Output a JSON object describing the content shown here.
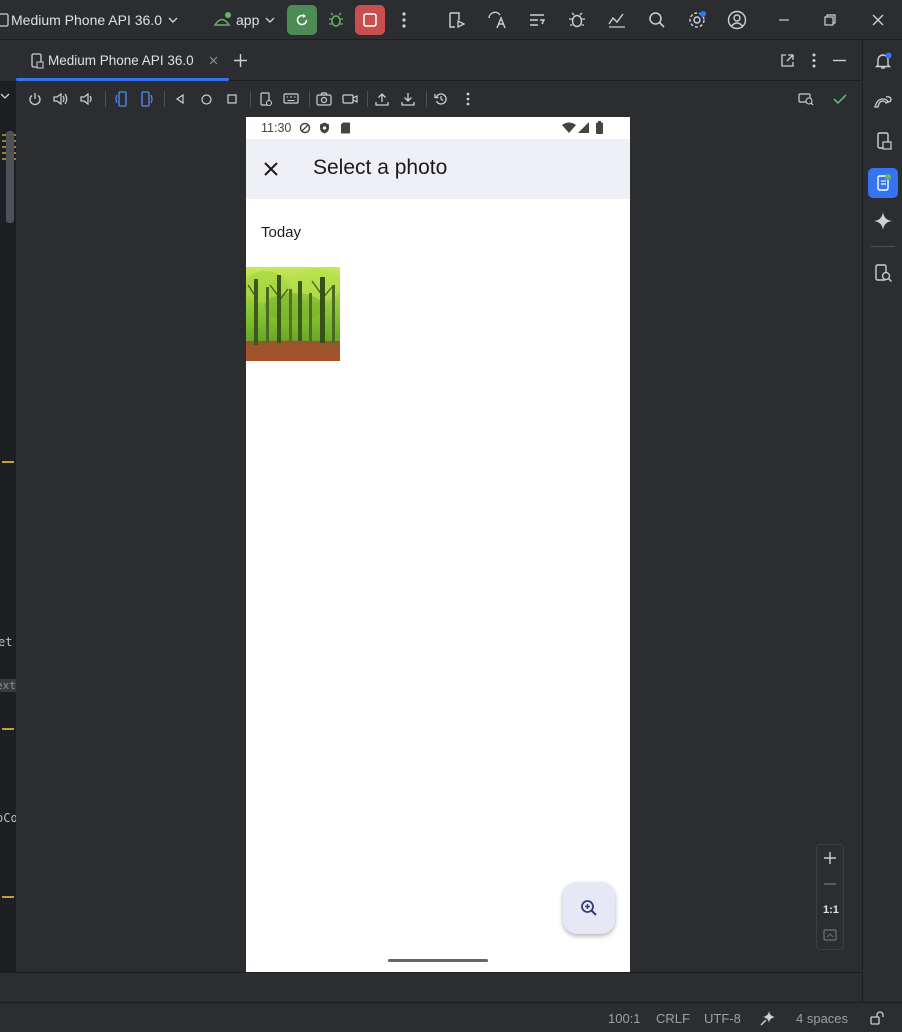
{
  "titlebar": {
    "device_name": "Medium Phone API 36.0",
    "run_config": "app"
  },
  "tab": {
    "label": "Medium Phone API 36.0"
  },
  "phone": {
    "status_time": "11:30",
    "appbar_title": "Select a photo",
    "section_label": "Today"
  },
  "left_strip": {
    "snippet_1": "et",
    "snippet_2": "ext",
    "snippet_3": "oCo"
  },
  "zoom": {
    "one_to_one": "1:1"
  },
  "statusbar": {
    "position": "100:1",
    "line_ending": "CRLF",
    "encoding": "UTF-8",
    "indent": "4 spaces"
  },
  "colors": {
    "accent": "#3574f0",
    "run_button": "#4e8a53",
    "stop_button": "#c94f4f",
    "ide_background": "#2b2d30",
    "phone_appbar": "#eff0f5",
    "fab": "#e6e8f5",
    "success": "#5fb865"
  }
}
